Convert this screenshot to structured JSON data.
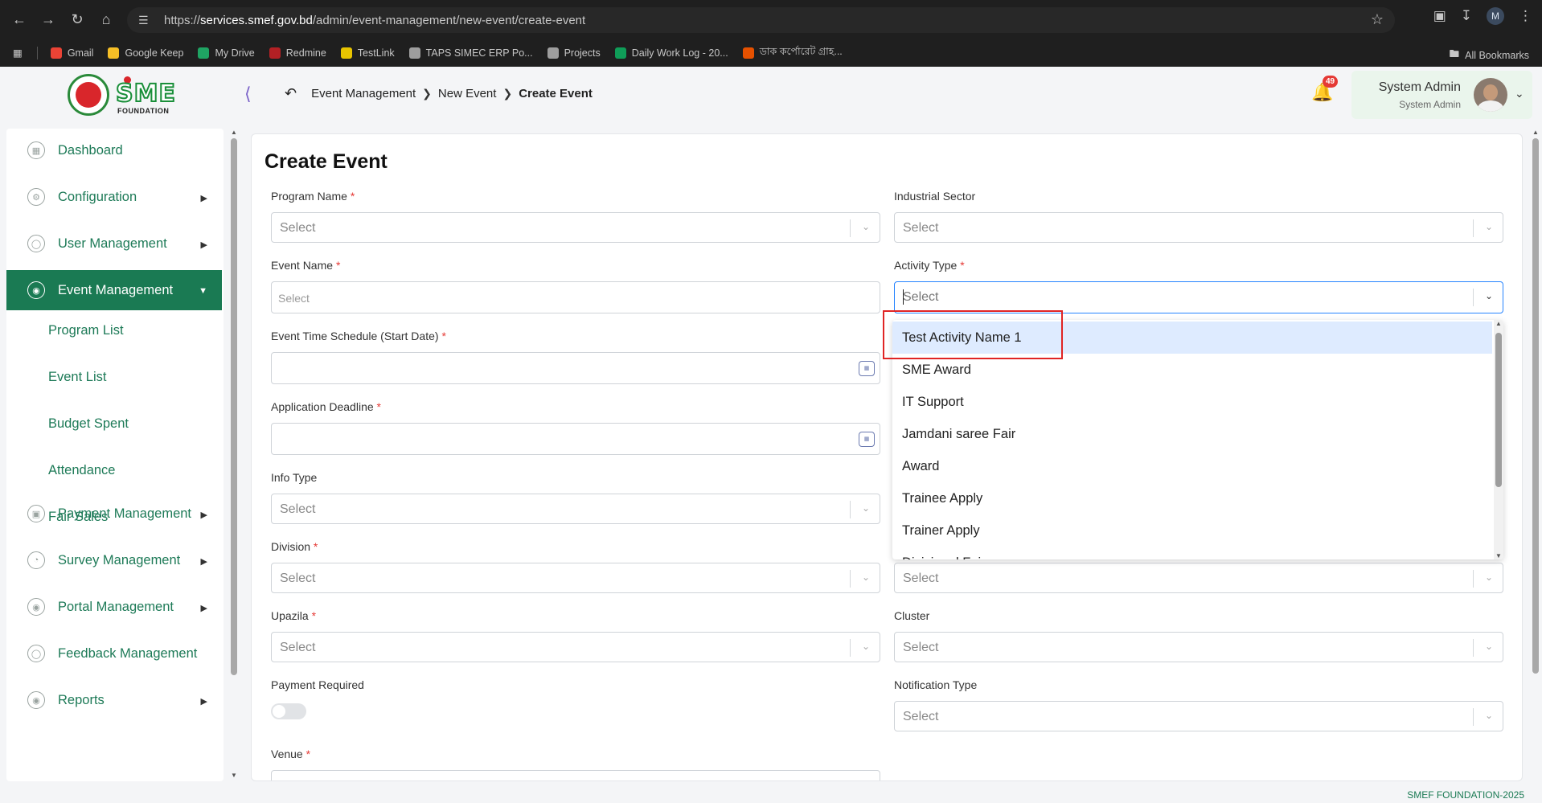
{
  "browser": {
    "url_scheme": "https://",
    "url_host": "services.smef.gov.bd",
    "url_path": "/admin/event-management/new-event/create-event",
    "profile_initial": "M",
    "bookmarks": [
      {
        "label": "Gmail",
        "color": "#ea4335"
      },
      {
        "label": "Google Keep",
        "color": "#f6bf26"
      },
      {
        "label": "My Drive",
        "color": "#1fa463"
      },
      {
        "label": "Redmine",
        "color": "#b32024"
      },
      {
        "label": "TestLink",
        "color": "#e8c400"
      },
      {
        "label": "TAPS SIMEC ERP Po...",
        "color": "#9e9e9e"
      },
      {
        "label": "Projects",
        "color": "#9e9e9e"
      },
      {
        "label": "Daily Work Log - 20...",
        "color": "#0f9d58"
      },
      {
        "label": "ডাক কর্পোরেট গ্রাহ...",
        "color": "#e65100"
      }
    ],
    "all_bookmarks": "All Bookmarks"
  },
  "header": {
    "logo_text": "SME",
    "logo_sub": "FOUNDATION",
    "breadcrumb": [
      "Event Management",
      "New Event",
      "Create Event"
    ],
    "notification_count": "49",
    "user_name": "System Admin",
    "user_role": "System Admin"
  },
  "sidebar": {
    "items": [
      {
        "label": "Dashboard",
        "icon": "grid-icon",
        "has_arrow": false,
        "active": false
      },
      {
        "label": "Configuration",
        "icon": "config-icon",
        "has_arrow": true,
        "active": false
      },
      {
        "label": "User Management",
        "icon": "shield-user-icon",
        "has_arrow": true,
        "active": false
      },
      {
        "label": "Event Management",
        "icon": "event-icon",
        "has_arrow": true,
        "active": true
      },
      {
        "label": "Payment Management",
        "icon": "payment-icon",
        "has_arrow": true,
        "active": false
      },
      {
        "label": "Survey Management",
        "icon": "pie-chart-icon",
        "has_arrow": true,
        "active": false
      },
      {
        "label": "Portal Management",
        "icon": "portal-icon",
        "has_arrow": true,
        "active": false
      },
      {
        "label": "Feedback Management",
        "icon": "feedback-icon",
        "has_arrow": false,
        "active": false
      },
      {
        "label": "Reports",
        "icon": "reports-icon",
        "has_arrow": true,
        "active": false
      }
    ],
    "submenu": [
      "Program List",
      "Event List",
      "Budget Spent",
      "Attendance",
      "Fair Sales"
    ]
  },
  "form": {
    "title": "Create Event",
    "program_name": {
      "label": "Program Name",
      "required": "*",
      "placeholder": "Select"
    },
    "industrial_sector": {
      "label": "Industrial Sector",
      "placeholder": "Select"
    },
    "event_name": {
      "label": "Event Name",
      "required": "*",
      "placeholder": "Select"
    },
    "activity_type": {
      "label": "Activity Type",
      "required": "*",
      "placeholder": "Select"
    },
    "start_date": {
      "label": "Event Time Schedule (Start Date)",
      "required": "*"
    },
    "deadline": {
      "label": "Application Deadline",
      "required": "*"
    },
    "info_type": {
      "label": "Info Type",
      "placeholder": "Select"
    },
    "division": {
      "label": "Division",
      "required": "*",
      "placeholder": "Select"
    },
    "district": {
      "placeholder": "Select"
    },
    "upazila": {
      "label": "Upazila",
      "required": "*",
      "placeholder": "Select"
    },
    "cluster": {
      "label": "Cluster",
      "placeholder": "Select"
    },
    "payment_required": {
      "label": "Payment Required",
      "enabled": false
    },
    "notification_type": {
      "label": "Notification Type",
      "placeholder": "Select"
    },
    "venue": {
      "label": "Venue",
      "required": "*"
    }
  },
  "dropdown": {
    "options": [
      "Test Activity Name 1",
      "SME Award",
      "IT Support",
      "Jamdani saree Fair",
      "Award",
      "Trainee Apply",
      "Trainer Apply",
      "Divisional Fair"
    ],
    "highlighted_index": 0
  },
  "footer": {
    "copyright": "SMEF FOUNDATION-2025"
  },
  "colors": {
    "primary": "#1a7a53",
    "focus": "#2684ff",
    "highlight": "#deebff",
    "annotation": "#e02424"
  }
}
